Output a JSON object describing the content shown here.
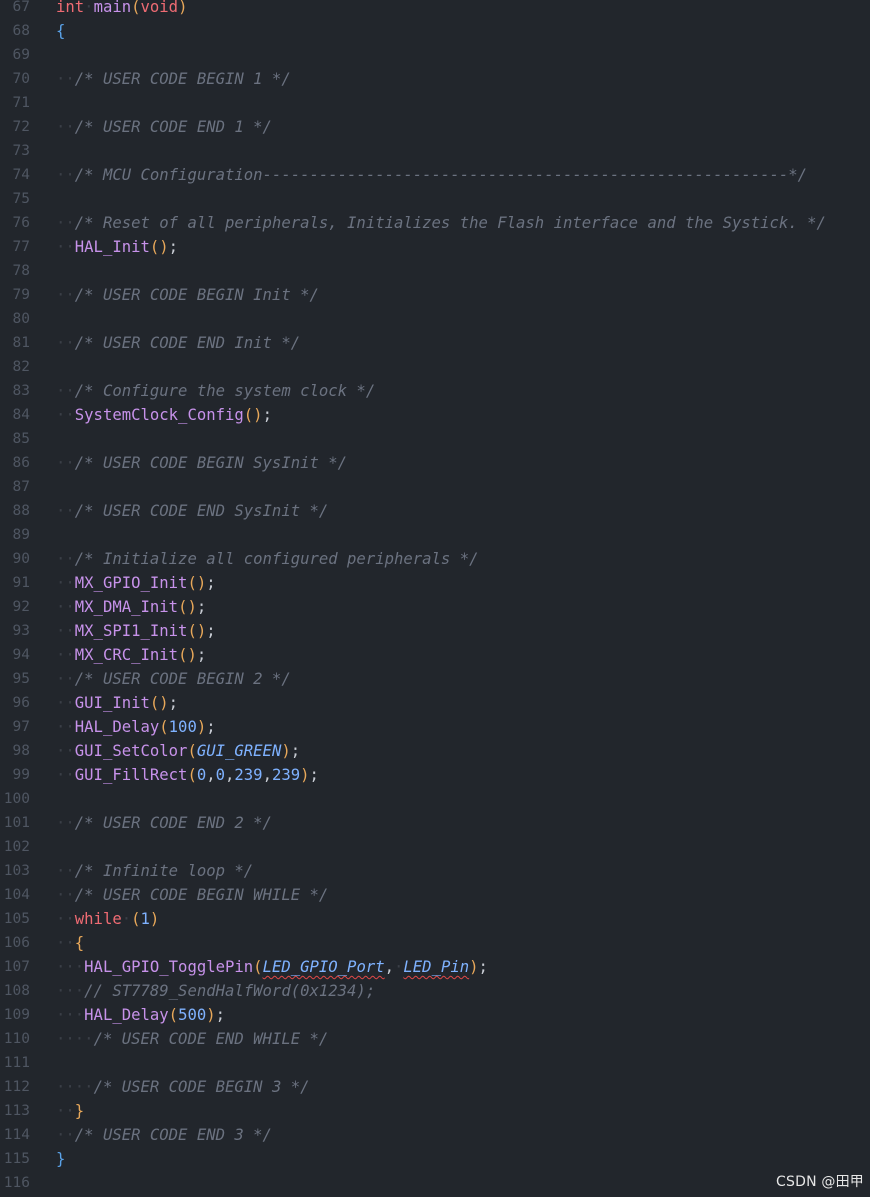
{
  "editor": {
    "lines": [
      {
        "n": "67",
        "tokens": [
          {
            "t": "int",
            "c": "type"
          },
          {
            "t": "·",
            "c": "ws"
          },
          {
            "t": "main",
            "c": "fn"
          },
          {
            "t": "(",
            "c": "paren"
          },
          {
            "t": "void",
            "c": "type"
          },
          {
            "t": ")",
            "c": "paren"
          }
        ]
      },
      {
        "n": "68",
        "tokens": [
          {
            "t": "{",
            "c": "brace"
          }
        ]
      },
      {
        "n": "69",
        "tokens": []
      },
      {
        "n": "70",
        "tokens": [
          {
            "t": "··",
            "c": "ws"
          },
          {
            "t": "/* USER CODE BEGIN 1 */",
            "c": "comment"
          }
        ]
      },
      {
        "n": "71",
        "tokens": []
      },
      {
        "n": "72",
        "tokens": [
          {
            "t": "··",
            "c": "ws"
          },
          {
            "t": "/* USER CODE END 1 */",
            "c": "comment"
          }
        ]
      },
      {
        "n": "73",
        "tokens": []
      },
      {
        "n": "74",
        "tokens": [
          {
            "t": "··",
            "c": "ws"
          },
          {
            "t": "/* MCU Configuration--------------------------------------------------------*/",
            "c": "comment"
          }
        ]
      },
      {
        "n": "75",
        "tokens": []
      },
      {
        "n": "76",
        "tokens": [
          {
            "t": "··",
            "c": "ws"
          },
          {
            "t": "/* Reset of all peripherals, Initializes the Flash interface and the Systick. */",
            "c": "comment"
          }
        ]
      },
      {
        "n": "77",
        "tokens": [
          {
            "t": "··",
            "c": "ws"
          },
          {
            "t": "HAL_Init",
            "c": "fn"
          },
          {
            "t": "()",
            "c": "paren"
          },
          {
            "t": ";",
            "c": "punc"
          }
        ]
      },
      {
        "n": "78",
        "tokens": []
      },
      {
        "n": "79",
        "tokens": [
          {
            "t": "··",
            "c": "ws"
          },
          {
            "t": "/* USER CODE BEGIN Init */",
            "c": "comment"
          }
        ]
      },
      {
        "n": "80",
        "tokens": []
      },
      {
        "n": "81",
        "tokens": [
          {
            "t": "··",
            "c": "ws"
          },
          {
            "t": "/* USER CODE END Init */",
            "c": "comment"
          }
        ]
      },
      {
        "n": "82",
        "tokens": []
      },
      {
        "n": "83",
        "tokens": [
          {
            "t": "··",
            "c": "ws"
          },
          {
            "t": "/* Configure the system clock */",
            "c": "comment"
          }
        ]
      },
      {
        "n": "84",
        "tokens": [
          {
            "t": "··",
            "c": "ws"
          },
          {
            "t": "SystemClock_Config",
            "c": "fn"
          },
          {
            "t": "()",
            "c": "paren"
          },
          {
            "t": ";",
            "c": "punc"
          }
        ]
      },
      {
        "n": "85",
        "tokens": []
      },
      {
        "n": "86",
        "tokens": [
          {
            "t": "··",
            "c": "ws"
          },
          {
            "t": "/* USER CODE BEGIN SysInit */",
            "c": "comment"
          }
        ]
      },
      {
        "n": "87",
        "tokens": []
      },
      {
        "n": "88",
        "tokens": [
          {
            "t": "··",
            "c": "ws"
          },
          {
            "t": "/* USER CODE END SysInit */",
            "c": "comment"
          }
        ]
      },
      {
        "n": "89",
        "tokens": []
      },
      {
        "n": "90",
        "tokens": [
          {
            "t": "··",
            "c": "ws"
          },
          {
            "t": "/* Initialize all configured peripherals */",
            "c": "comment"
          }
        ]
      },
      {
        "n": "91",
        "tokens": [
          {
            "t": "··",
            "c": "ws"
          },
          {
            "t": "MX_GPIO_Init",
            "c": "fn"
          },
          {
            "t": "()",
            "c": "paren"
          },
          {
            "t": ";",
            "c": "punc"
          }
        ]
      },
      {
        "n": "92",
        "tokens": [
          {
            "t": "··",
            "c": "ws"
          },
          {
            "t": "MX_DMA_Init",
            "c": "fn"
          },
          {
            "t": "()",
            "c": "paren"
          },
          {
            "t": ";",
            "c": "punc"
          }
        ]
      },
      {
        "n": "93",
        "tokens": [
          {
            "t": "··",
            "c": "ws"
          },
          {
            "t": "MX_SPI1_Init",
            "c": "fn"
          },
          {
            "t": "()",
            "c": "paren"
          },
          {
            "t": ";",
            "c": "punc"
          }
        ]
      },
      {
        "n": "94",
        "tokens": [
          {
            "t": "··",
            "c": "ws"
          },
          {
            "t": "MX_CRC_Init",
            "c": "fn"
          },
          {
            "t": "()",
            "c": "paren"
          },
          {
            "t": ";",
            "c": "punc"
          }
        ]
      },
      {
        "n": "95",
        "tokens": [
          {
            "t": "··",
            "c": "ws"
          },
          {
            "t": "/* USER CODE BEGIN 2 */",
            "c": "comment"
          }
        ]
      },
      {
        "n": "96",
        "tokens": [
          {
            "t": "··",
            "c": "ws"
          },
          {
            "t": "GUI_Init",
            "c": "fn"
          },
          {
            "t": "()",
            "c": "paren"
          },
          {
            "t": ";",
            "c": "punc"
          }
        ]
      },
      {
        "n": "97",
        "tokens": [
          {
            "t": "··",
            "c": "ws"
          },
          {
            "t": "HAL_Delay",
            "c": "fn"
          },
          {
            "t": "(",
            "c": "paren"
          },
          {
            "t": "100",
            "c": "num"
          },
          {
            "t": ")",
            "c": "paren"
          },
          {
            "t": ";",
            "c": "punc"
          }
        ]
      },
      {
        "n": "98",
        "tokens": [
          {
            "t": "··",
            "c": "ws"
          },
          {
            "t": "GUI_SetColor",
            "c": "fn"
          },
          {
            "t": "(",
            "c": "paren"
          },
          {
            "t": "GUI_GREEN",
            "c": "macro"
          },
          {
            "t": ")",
            "c": "paren"
          },
          {
            "t": ";",
            "c": "punc"
          }
        ]
      },
      {
        "n": "99",
        "tokens": [
          {
            "t": "··",
            "c": "ws"
          },
          {
            "t": "GUI_FillRect",
            "c": "fn"
          },
          {
            "t": "(",
            "c": "paren"
          },
          {
            "t": "0",
            "c": "num"
          },
          {
            "t": ",",
            "c": "punc"
          },
          {
            "t": "0",
            "c": "num"
          },
          {
            "t": ",",
            "c": "punc"
          },
          {
            "t": "239",
            "c": "num"
          },
          {
            "t": ",",
            "c": "punc"
          },
          {
            "t": "239",
            "c": "num"
          },
          {
            "t": ")",
            "c": "paren"
          },
          {
            "t": ";",
            "c": "punc"
          }
        ]
      },
      {
        "n": "100",
        "tokens": []
      },
      {
        "n": "101",
        "tokens": [
          {
            "t": "··",
            "c": "ws"
          },
          {
            "t": "/* USER CODE END 2 */",
            "c": "comment"
          }
        ]
      },
      {
        "n": "102",
        "tokens": []
      },
      {
        "n": "103",
        "tokens": [
          {
            "t": "··",
            "c": "ws"
          },
          {
            "t": "/* Infinite loop */",
            "c": "comment"
          }
        ]
      },
      {
        "n": "104",
        "tokens": [
          {
            "t": "··",
            "c": "ws"
          },
          {
            "t": "/* USER CODE BEGIN WHILE */",
            "c": "comment"
          }
        ]
      },
      {
        "n": "105",
        "tokens": [
          {
            "t": "··",
            "c": "ws"
          },
          {
            "t": "while",
            "c": "kw"
          },
          {
            "t": "·",
            "c": "ws"
          },
          {
            "t": "(",
            "c": "paren"
          },
          {
            "t": "1",
            "c": "num"
          },
          {
            "t": ")",
            "c": "paren"
          }
        ]
      },
      {
        "n": "106",
        "tokens": [
          {
            "t": "··",
            "c": "ws"
          },
          {
            "t": "{",
            "c": "brace-in"
          }
        ]
      },
      {
        "n": "107",
        "tokens": [
          {
            "t": "···",
            "c": "ws"
          },
          {
            "t": "HAL_GPIO_TogglePin",
            "c": "fn"
          },
          {
            "t": "(",
            "c": "paren"
          },
          {
            "t": "LED_GPIO_Port",
            "c": "macro",
            "sq": true
          },
          {
            "t": ",",
            "c": "punc"
          },
          {
            "t": "·",
            "c": "ws"
          },
          {
            "t": "LED_Pin",
            "c": "macro",
            "sq": true
          },
          {
            "t": ")",
            "c": "paren"
          },
          {
            "t": ";",
            "c": "punc"
          }
        ]
      },
      {
        "n": "108",
        "tokens": [
          {
            "t": "···",
            "c": "ws"
          },
          {
            "t": "// ST7789_SendHalfWord(0x1234);",
            "c": "comment"
          }
        ]
      },
      {
        "n": "109",
        "tokens": [
          {
            "t": "···",
            "c": "ws"
          },
          {
            "t": "HAL_Delay",
            "c": "fn"
          },
          {
            "t": "(",
            "c": "paren"
          },
          {
            "t": "500",
            "c": "num"
          },
          {
            "t": ")",
            "c": "paren"
          },
          {
            "t": ";",
            "c": "punc"
          }
        ]
      },
      {
        "n": "110",
        "tokens": [
          {
            "t": "····",
            "c": "ws"
          },
          {
            "t": "/* USER CODE END WHILE */",
            "c": "comment"
          }
        ]
      },
      {
        "n": "111",
        "tokens": []
      },
      {
        "n": "112",
        "tokens": [
          {
            "t": "····",
            "c": "ws"
          },
          {
            "t": "/* USER CODE BEGIN 3 */",
            "c": "comment"
          }
        ]
      },
      {
        "n": "113",
        "tokens": [
          {
            "t": "··",
            "c": "ws"
          },
          {
            "t": "}",
            "c": "brace-in"
          }
        ]
      },
      {
        "n": "114",
        "tokens": [
          {
            "t": "··",
            "c": "ws"
          },
          {
            "t": "/* USER CODE END 3 */",
            "c": "comment"
          }
        ]
      },
      {
        "n": "115",
        "tokens": [
          {
            "t": "}",
            "c": "brace"
          }
        ]
      },
      {
        "n": "116",
        "tokens": []
      }
    ]
  },
  "watermark": "CSDN @田甲"
}
